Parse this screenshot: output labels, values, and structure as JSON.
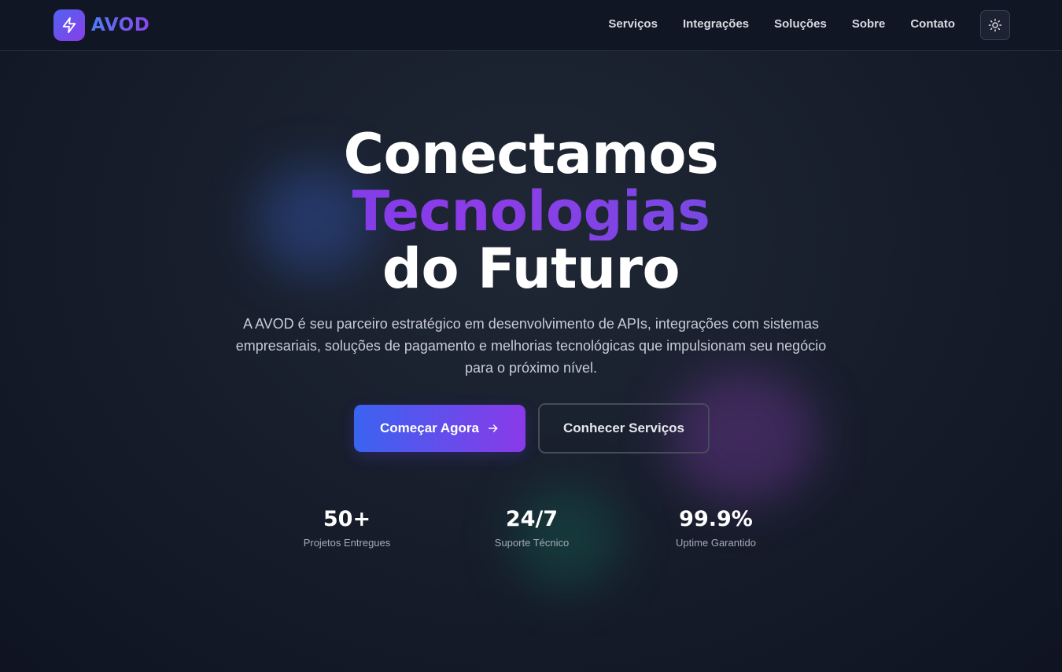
{
  "header": {
    "brand": "AVOD",
    "nav": [
      "Serviços",
      "Integrações",
      "Soluções",
      "Sobre",
      "Contato"
    ],
    "theme_toggle_icon": "sun-icon"
  },
  "hero": {
    "title_line1": "Conectamos",
    "title_line2": "Tecnologias",
    "title_line3": "do Futuro",
    "description": "A AVOD é seu parceiro estratégico em desenvolvimento de APIs, integrações com sistemas empresariais, soluções de pagamento e melhorias tecnológicas que impulsionam seu negócio para o próximo nível.",
    "primary_cta": "Começar Agora",
    "secondary_cta": "Conhecer Serviços"
  },
  "stats": [
    {
      "value": "50+",
      "label": "Projetos Entregues"
    },
    {
      "value": "24/7",
      "label": "Suporte Técnico"
    },
    {
      "value": "99.9%",
      "label": "Uptime Garantido"
    }
  ],
  "colors": {
    "background": "#161c2a",
    "accent_blue": "#3a63f0",
    "accent_purple": "#8a3ae8"
  }
}
